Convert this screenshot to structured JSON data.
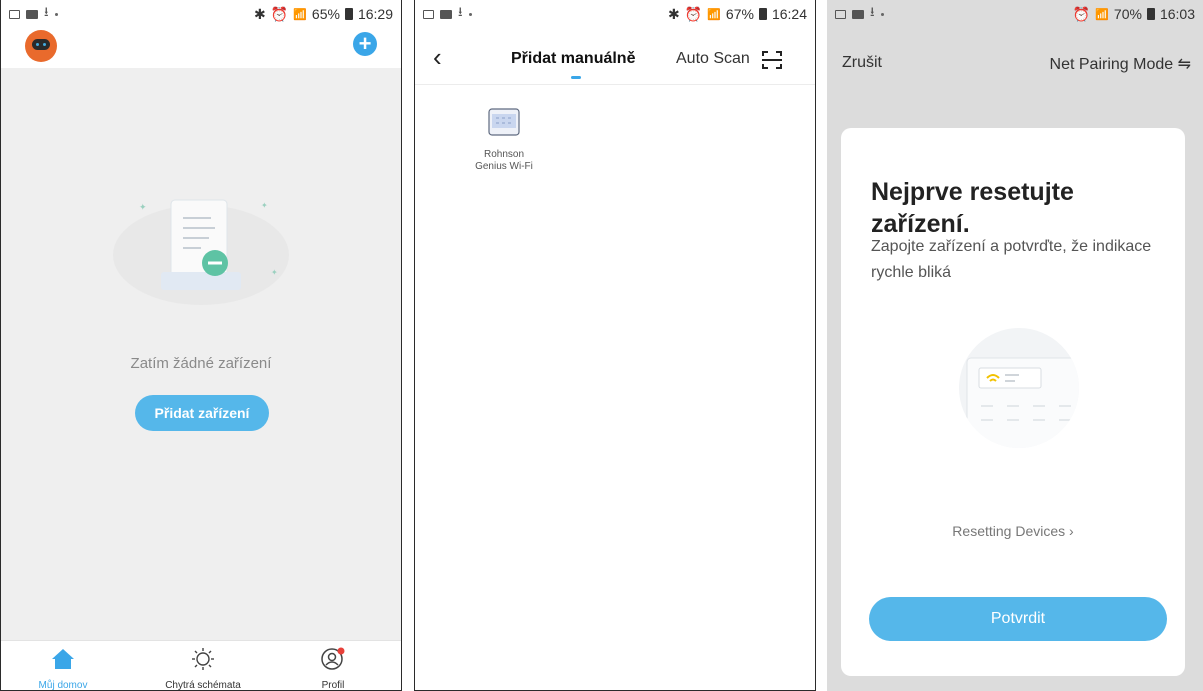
{
  "screen1": {
    "status": {
      "battery": "65%",
      "time": "16:29"
    },
    "empty_text": "Zatím žádné zařízení",
    "add_button": "Přidat zařízení",
    "tabs": [
      {
        "label": "Můj domov",
        "icon": "home-icon"
      },
      {
        "label": "Chytrá schémata",
        "icon": "sun-icon"
      },
      {
        "label": "Profil",
        "icon": "profile-icon"
      }
    ],
    "colors": {
      "accent": "#3aa6e8",
      "button": "#55b7ea"
    }
  },
  "screen2": {
    "status": {
      "battery": "67%",
      "time": "16:24"
    },
    "title": "Přidat manuálně",
    "auto_scan": "Auto Scan",
    "device": {
      "line1": "Rohnson",
      "line2": "Genius Wi-Fi"
    }
  },
  "screen3": {
    "status": {
      "battery": "70%",
      "time": "16:03"
    },
    "cancel": "Zrušit",
    "net_mode": "Net Pairing Mode ⇋",
    "title": "Nejprve resetujte zařízení.",
    "subtitle": "Zapojte zařízení a potvrďte, že indikace rychle bliká",
    "resetting_link": "Resetting Devices  ›",
    "confirm": "Potvrdit"
  }
}
